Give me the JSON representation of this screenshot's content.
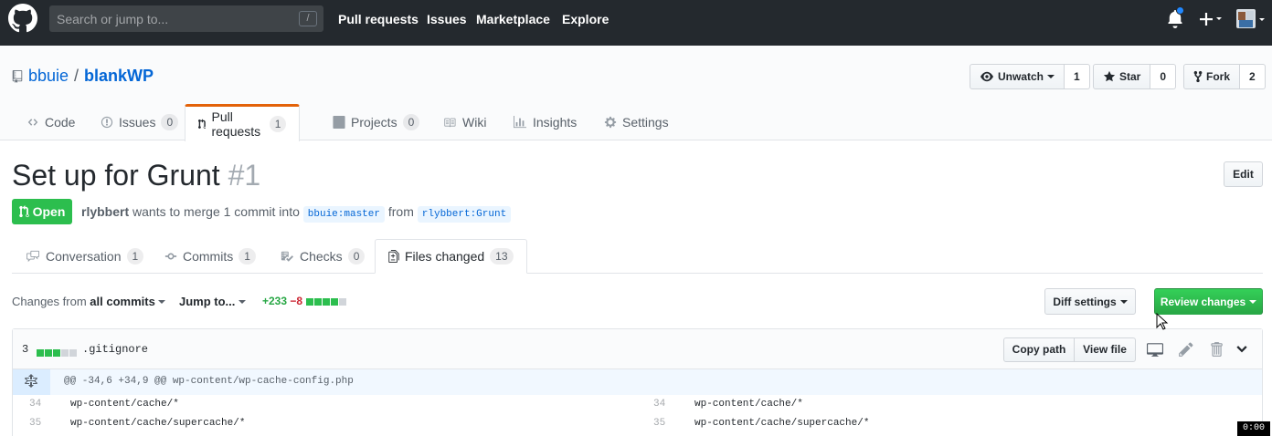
{
  "header": {
    "search_placeholder": "Search or jump to...",
    "search_shortcut": "/",
    "nav": [
      "Pull requests",
      "Issues",
      "Marketplace",
      "Explore"
    ]
  },
  "repo": {
    "owner": "bbuie",
    "separator": "/",
    "name": "blankWP",
    "unwatch_label": "Unwatch",
    "unwatch_count": "1",
    "star_label": "Star",
    "star_count": "0",
    "fork_label": "Fork",
    "fork_count": "2",
    "tabs": [
      {
        "label": "Code",
        "count": ""
      },
      {
        "label": "Issues",
        "count": "0"
      },
      {
        "label": "Pull requests",
        "count": "1"
      },
      {
        "label": "Projects",
        "count": "0"
      },
      {
        "label": "Wiki",
        "count": ""
      },
      {
        "label": "Insights",
        "count": ""
      },
      {
        "label": "Settings",
        "count": ""
      }
    ]
  },
  "pr": {
    "title": "Set up for Grunt",
    "number": "#1",
    "edit_label": "Edit",
    "state": "Open",
    "author": "rlybbert",
    "meta_text": "wants to merge 1 commit into",
    "base_branch": "bbuie:master",
    "from_text": "from",
    "head_branch": "rlybbert:Grunt",
    "tabs": [
      {
        "label": "Conversation",
        "count": "1"
      },
      {
        "label": "Commits",
        "count": "1"
      },
      {
        "label": "Checks",
        "count": "0"
      },
      {
        "label": "Files changed",
        "count": "13"
      }
    ]
  },
  "toolbar": {
    "changes_from": "Changes from",
    "all_commits": "all commits",
    "jump_to": "Jump to...",
    "additions": "+233",
    "deletions": "−8",
    "diff_settings": "Diff settings",
    "review_changes": "Review changes"
  },
  "file": {
    "change_count": "3",
    "name": ".gitignore",
    "copy_path": "Copy path",
    "view_file": "View file",
    "hunk_header": "@@ -34,6 +34,9 @@ wp-content/wp-cache-config.php",
    "lines": [
      {
        "left_num": "34",
        "left_code": "wp-content/cache/*",
        "right_num": "34",
        "right_code": "wp-content/cache/*"
      },
      {
        "left_num": "35",
        "left_code": "wp-content/cache/supercache/*",
        "right_num": "35",
        "right_code": "wp-content/cache/supercache/*"
      }
    ]
  },
  "timer": "0:00",
  "colors": {
    "header_bg": "#24292e",
    "link_blue": "#0366d6",
    "success_green": "#2cbe4e",
    "tab_accent": "#e36209"
  }
}
